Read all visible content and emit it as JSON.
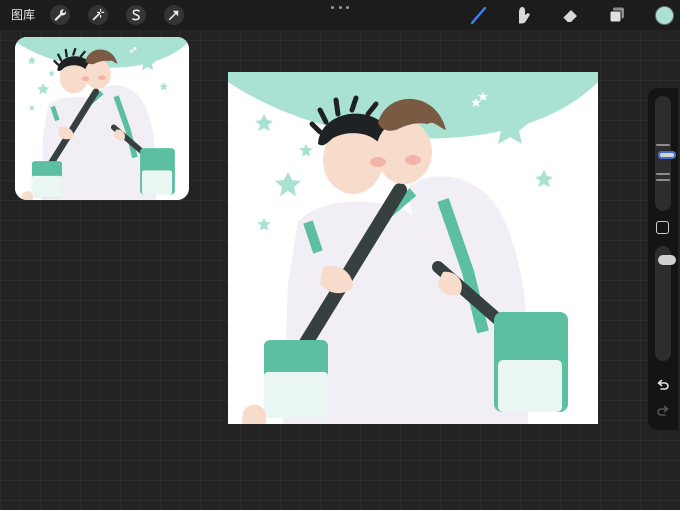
{
  "topbar": {
    "gallery_label": "图库",
    "left_tools": [
      "wrench-icon",
      "magic-wand-icon",
      "selection-s-icon",
      "arrow-transform-icon"
    ],
    "right_tools": [
      "brush-icon",
      "smudge-icon",
      "eraser-icon",
      "layers-icon"
    ],
    "active_tool": "brush-icon",
    "current_color": "#a9e1d3"
  },
  "colors": {
    "accent_blue": "#3b82f6",
    "mint": "#a9e1d3",
    "mint_dark": "#7fcdb8",
    "bag_green": "#5cbfa1",
    "hair_dark": "#1e2224",
    "hair_brown": "#7a5a42",
    "skin": "#f8dccb",
    "jacket": "#f1eef6"
  },
  "sidebar": {
    "size_slider_value": 0.22,
    "opacity_slider_value": 0.5
  }
}
